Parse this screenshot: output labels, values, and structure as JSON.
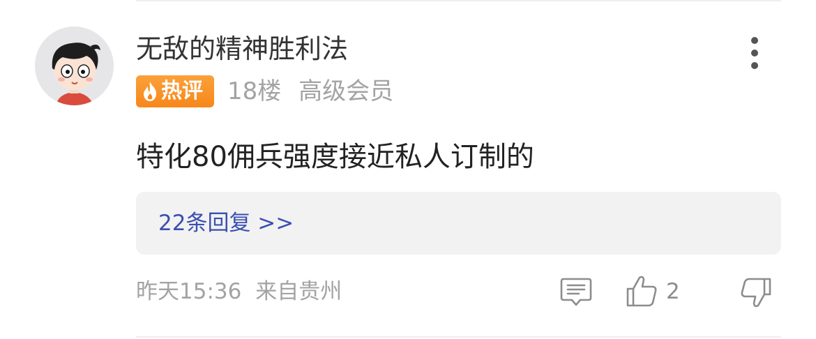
{
  "comment": {
    "username": "无敌的精神胜利法",
    "badge_label": "热评",
    "floor": "18楼",
    "member_level": "高级会员",
    "body": "特化80佣兵强度接近私人订制的",
    "replies_link": "22条回复 >>",
    "time": "昨天15:36",
    "location": "来自贵州",
    "like_count": "2"
  },
  "icons": {
    "avatar": "cartoon-avatar",
    "more": "vertical-ellipsis-icon",
    "badge": "flame-icon",
    "reply": "comment-icon",
    "like": "thumbs-up-icon",
    "dislike": "thumbs-down-icon"
  },
  "colors": {
    "badge_orange": "#f6871a",
    "link_blue": "#3b4fb0",
    "meta_gray": "#a3a3a3",
    "reply_box_bg": "#f2f2f3"
  }
}
